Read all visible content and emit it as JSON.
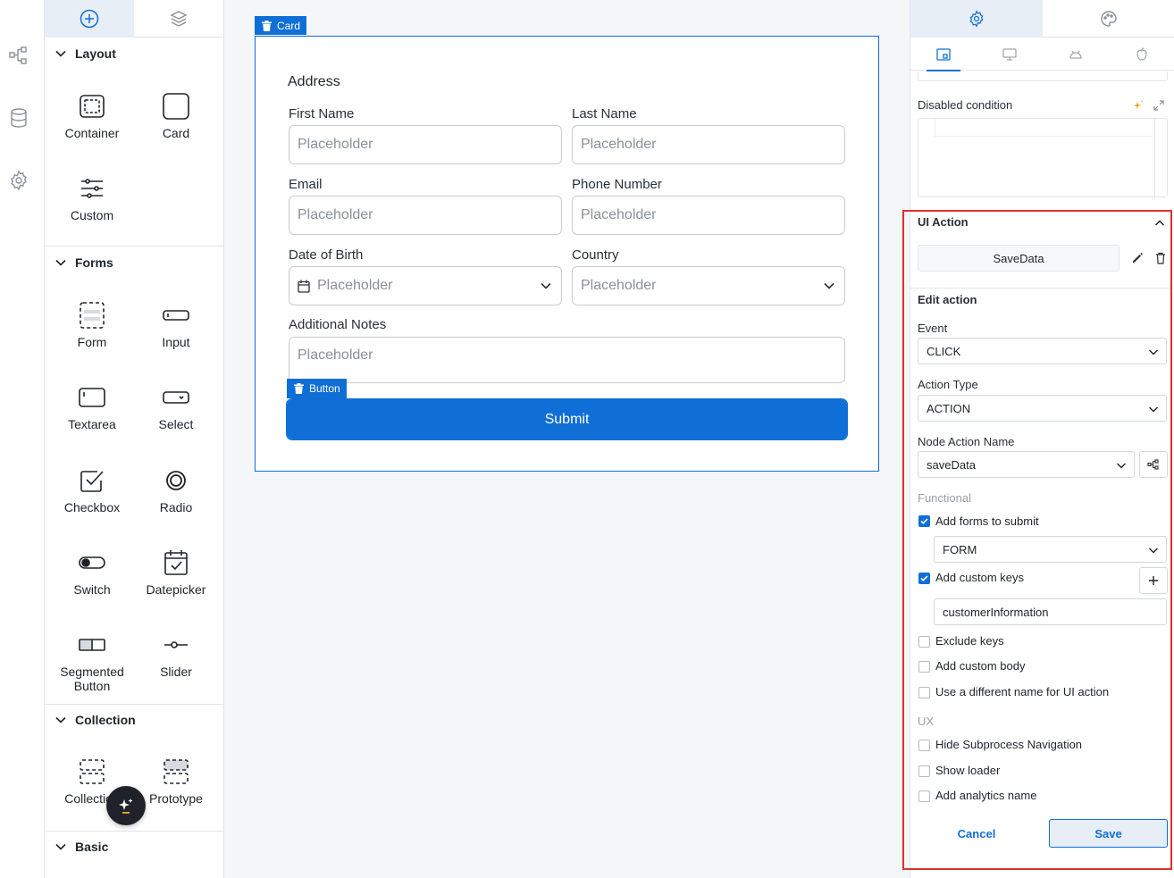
{
  "left_panel": {
    "sections": [
      {
        "title": "Layout",
        "items": [
          {
            "label": "Container",
            "icon": "container-icon"
          },
          {
            "label": "Card",
            "icon": "card-icon"
          },
          {
            "label": "Custom",
            "icon": "sliders-icon"
          }
        ]
      },
      {
        "title": "Forms",
        "items": [
          {
            "label": "Form",
            "icon": "form-icon"
          },
          {
            "label": "Input",
            "icon": "input-icon"
          },
          {
            "label": "Textarea",
            "icon": "textarea-icon"
          },
          {
            "label": "Select",
            "icon": "select-icon"
          },
          {
            "label": "Checkbox",
            "icon": "checkbox-icon"
          },
          {
            "label": "Radio",
            "icon": "radio-icon"
          },
          {
            "label": "Switch",
            "icon": "switch-icon"
          },
          {
            "label": "Datepicker",
            "icon": "calendar-icon"
          },
          {
            "label": "Segmented Button",
            "icon": "segmented-icon"
          },
          {
            "label": "Slider",
            "icon": "slider-icon"
          }
        ]
      },
      {
        "title": "Collection",
        "items": [
          {
            "label": "Collection",
            "icon": "collection-icon"
          },
          {
            "label": "Prototype",
            "icon": "prototype-icon"
          }
        ]
      },
      {
        "title": "Basic",
        "items": []
      }
    ]
  },
  "canvas": {
    "card_tag": "Card",
    "button_tag": "Button",
    "card_title": "Address",
    "fields": [
      {
        "label": "First Name",
        "placeholder": "Placeholder"
      },
      {
        "label": "Last Name",
        "placeholder": "Placeholder"
      },
      {
        "label": "Email",
        "placeholder": "Placeholder"
      },
      {
        "label": "Phone Number",
        "placeholder": "Placeholder"
      },
      {
        "label": "Date of Birth",
        "placeholder": "Placeholder"
      },
      {
        "label": "Country",
        "placeholder": "Placeholder"
      },
      {
        "label": "Additional Notes",
        "placeholder": "Placeholder"
      }
    ],
    "submit_label": "Submit"
  },
  "right_panel": {
    "disabled_condition_label": "Disabled condition",
    "ui_action_title": "UI Action",
    "ui_action_name": "SaveData",
    "edit_action_title": "Edit action",
    "event": {
      "label": "Event",
      "value": "CLICK"
    },
    "action_type": {
      "label": "Action Type",
      "value": "ACTION"
    },
    "node_action_name": {
      "label": "Node Action Name",
      "value": "saveData"
    },
    "functional_label": "Functional",
    "add_forms_to_submit": {
      "label": "Add forms to submit",
      "checked": true,
      "value": "FORM"
    },
    "add_custom_keys": {
      "label": "Add custom keys",
      "checked": true,
      "value": "customerInformation"
    },
    "exclude_keys": {
      "label": "Exclude keys",
      "checked": false
    },
    "add_custom_body": {
      "label": "Add custom body",
      "checked": false
    },
    "different_name": {
      "label": "Use a different name for UI action",
      "checked": false
    },
    "ux_label": "UX",
    "hide_subprocess": {
      "label": "Hide Subprocess Navigation",
      "checked": false
    },
    "show_loader": {
      "label": "Show loader",
      "checked": false
    },
    "analytics_name": {
      "label": "Add analytics name",
      "checked": false
    },
    "cancel_label": "Cancel",
    "save_label": "Save"
  },
  "colors": {
    "accent": "#0f6fd6",
    "highlight_border": "#e0312b",
    "ai_spark": "#f5a623"
  }
}
